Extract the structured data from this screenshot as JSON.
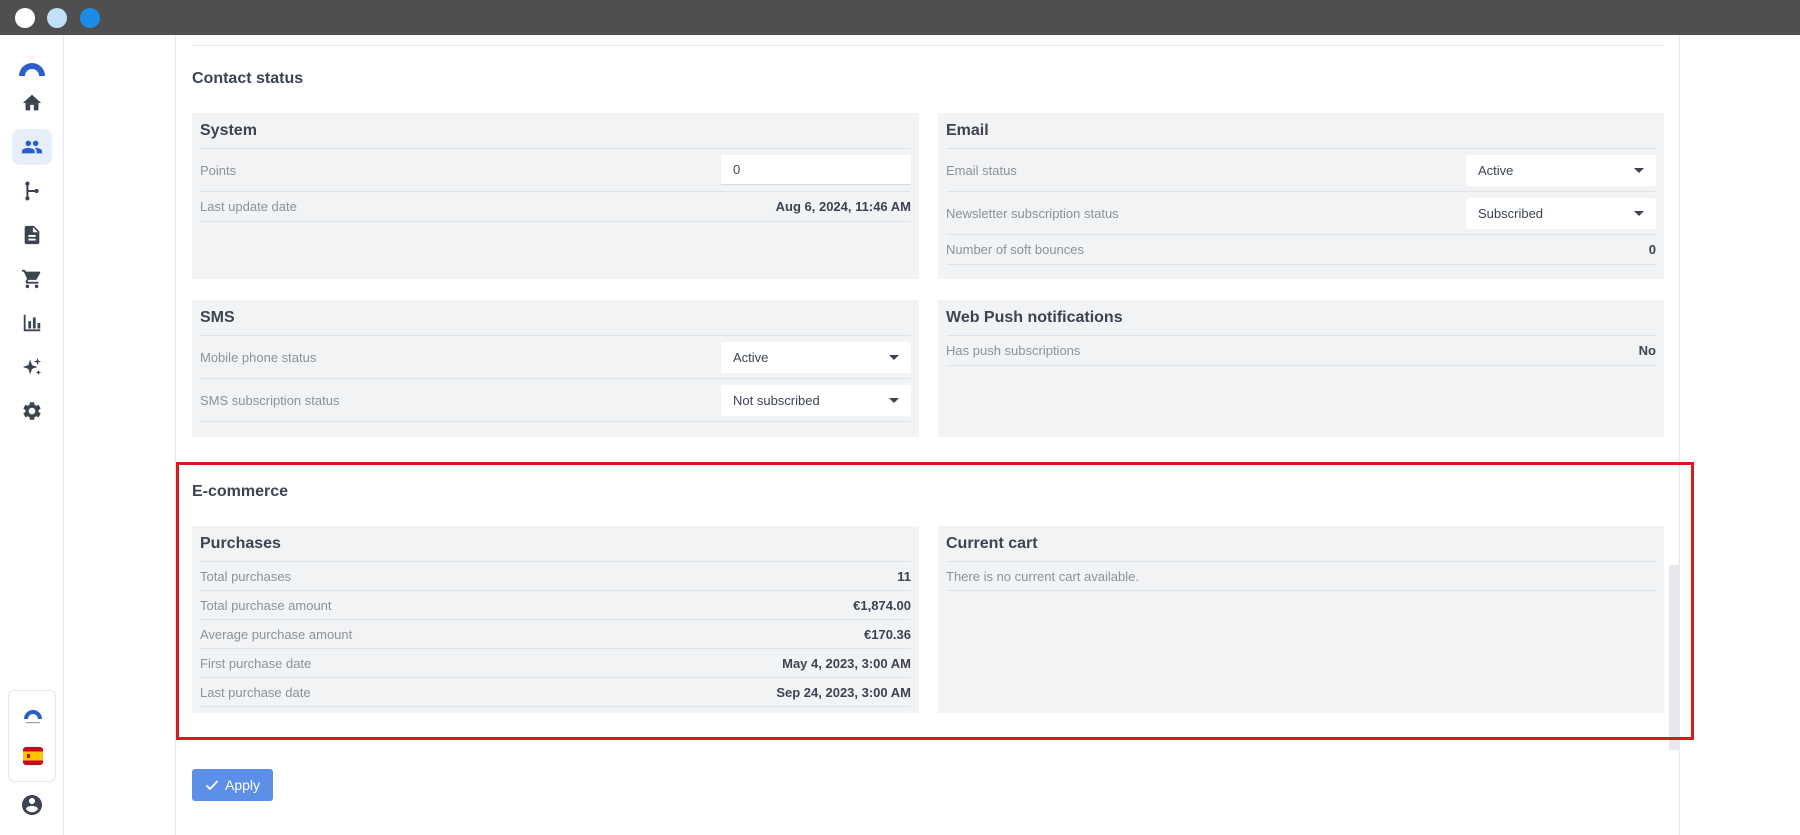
{
  "window": {
    "dot_colors": [
      "#ffffff",
      "#bfe0f7",
      "#1a8be6"
    ]
  },
  "sidebar": {
    "items": [
      {
        "icon": "home-icon"
      },
      {
        "icon": "contacts-icon",
        "active": true
      },
      {
        "icon": "flow-icon"
      },
      {
        "icon": "document-icon"
      },
      {
        "icon": "cart-icon"
      },
      {
        "icon": "bar-chart-icon"
      },
      {
        "icon": "sparkle-icon"
      },
      {
        "icon": "gear-icon"
      }
    ],
    "accent_color": "#2b5fc9"
  },
  "contact_status": {
    "title": "Contact status",
    "system": {
      "title": "System",
      "points_label": "Points",
      "points_value": "0",
      "last_update_label": "Last update date",
      "last_update_value": "Aug 6, 2024, 11:46 AM"
    },
    "email": {
      "title": "Email",
      "email_status_label": "Email status",
      "email_status_value": "Active",
      "newsletter_label": "Newsletter subscription status",
      "newsletter_value": "Subscribed",
      "soft_bounces_label": "Number of soft bounces",
      "soft_bounces_value": "0"
    },
    "sms": {
      "title": "SMS",
      "mobile_status_label": "Mobile phone status",
      "mobile_status_value": "Active",
      "sms_subscription_label": "SMS subscription status",
      "sms_subscription_value": "Not subscribed"
    },
    "web_push": {
      "title": "Web Push notifications",
      "has_push_label": "Has push subscriptions",
      "has_push_value": "No"
    }
  },
  "ecommerce": {
    "title": "E-commerce",
    "purchases": {
      "title": "Purchases",
      "rows": [
        {
          "label": "Total purchases",
          "value": "11"
        },
        {
          "label": "Total purchase amount",
          "value": "€1,874.00"
        },
        {
          "label": "Average purchase amount",
          "value": "€170.36"
        },
        {
          "label": "First purchase date",
          "value": "May 4, 2023, 3:00 AM"
        },
        {
          "label": "Last purchase date",
          "value": "Sep 24, 2023, 3:00 AM"
        }
      ]
    },
    "current_cart": {
      "title": "Current cart",
      "empty_message": "There is no current cart available."
    }
  },
  "actions": {
    "apply_label": "Apply",
    "apply_color": "#5b8fe8"
  },
  "highlight_color": "#d71920"
}
